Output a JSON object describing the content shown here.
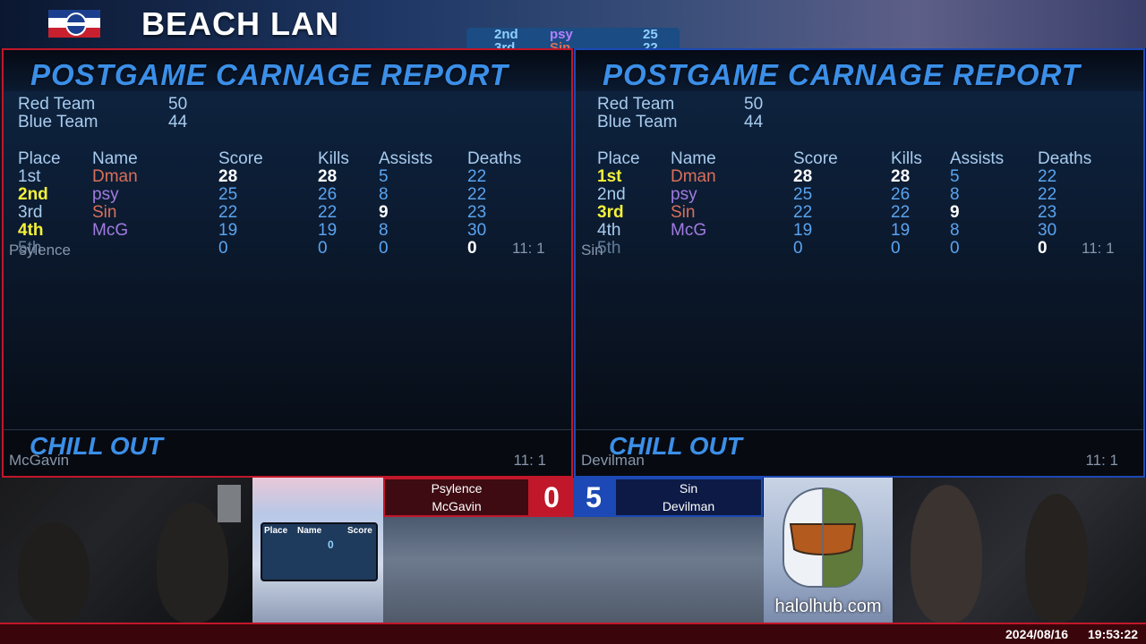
{
  "header": {
    "title": "BEACH LAN"
  },
  "mini_scoreboard": [
    {
      "place": "2nd",
      "name": "psy",
      "score": "25"
    },
    {
      "place": "3rd",
      "name": "Sin",
      "score": "22"
    }
  ],
  "report_title": "POSTGAME CARNAGE REPORT",
  "teams": [
    {
      "name": "Red Team",
      "score": "50"
    },
    {
      "name": "Blue Team",
      "score": "44"
    }
  ],
  "columns": [
    "Place",
    "Name",
    "Score",
    "Kills",
    "Assists",
    "Deaths"
  ],
  "rows": [
    {
      "place": "1st",
      "name": "Dman",
      "score": "28",
      "kills": "28",
      "assists": "5",
      "deaths": "22"
    },
    {
      "place": "2nd",
      "name": "psy",
      "score": "25",
      "kills": "26",
      "assists": "8",
      "deaths": "22"
    },
    {
      "place": "3rd",
      "name": "Sin",
      "score": "22",
      "kills": "22",
      "assists": "9",
      "deaths": "23"
    },
    {
      "place": "4th",
      "name": "McG",
      "score": "19",
      "kills": "19",
      "assists": "8",
      "deaths": "30"
    },
    {
      "place": "5th",
      "name": "",
      "score": "0",
      "kills": "0",
      "assists": "0",
      "deaths": "0"
    }
  ],
  "panels": [
    {
      "overlay_name": "Psylence",
      "overlay_score": "11: 1",
      "map_name": "CHILL OUT",
      "player_name": "McGavin",
      "player_score": "11: 1"
    },
    {
      "overlay_name": "Sin",
      "overlay_score": "11: 1",
      "map_name": "CHILL OUT",
      "player_name": "Devilman",
      "player_score": "11: 1"
    }
  ],
  "match": {
    "red_players": [
      "Psylence",
      "McGavin"
    ],
    "red_score": "0",
    "blue_score": "5",
    "blue_players": [
      "Sin",
      "Devilman"
    ]
  },
  "mini_table": {
    "headers": [
      "Place",
      "Name",
      "Score"
    ],
    "value": "0"
  },
  "sponsor": {
    "site": "halolhub.com"
  },
  "status": {
    "date": "2024/08/16",
    "time": "19:53:22"
  },
  "colors": {
    "red_accent": "#c1172a",
    "blue_accent": "#1c49b5",
    "highlight_yellow": "#f4f239",
    "report_blue": "#3b8fe8"
  }
}
